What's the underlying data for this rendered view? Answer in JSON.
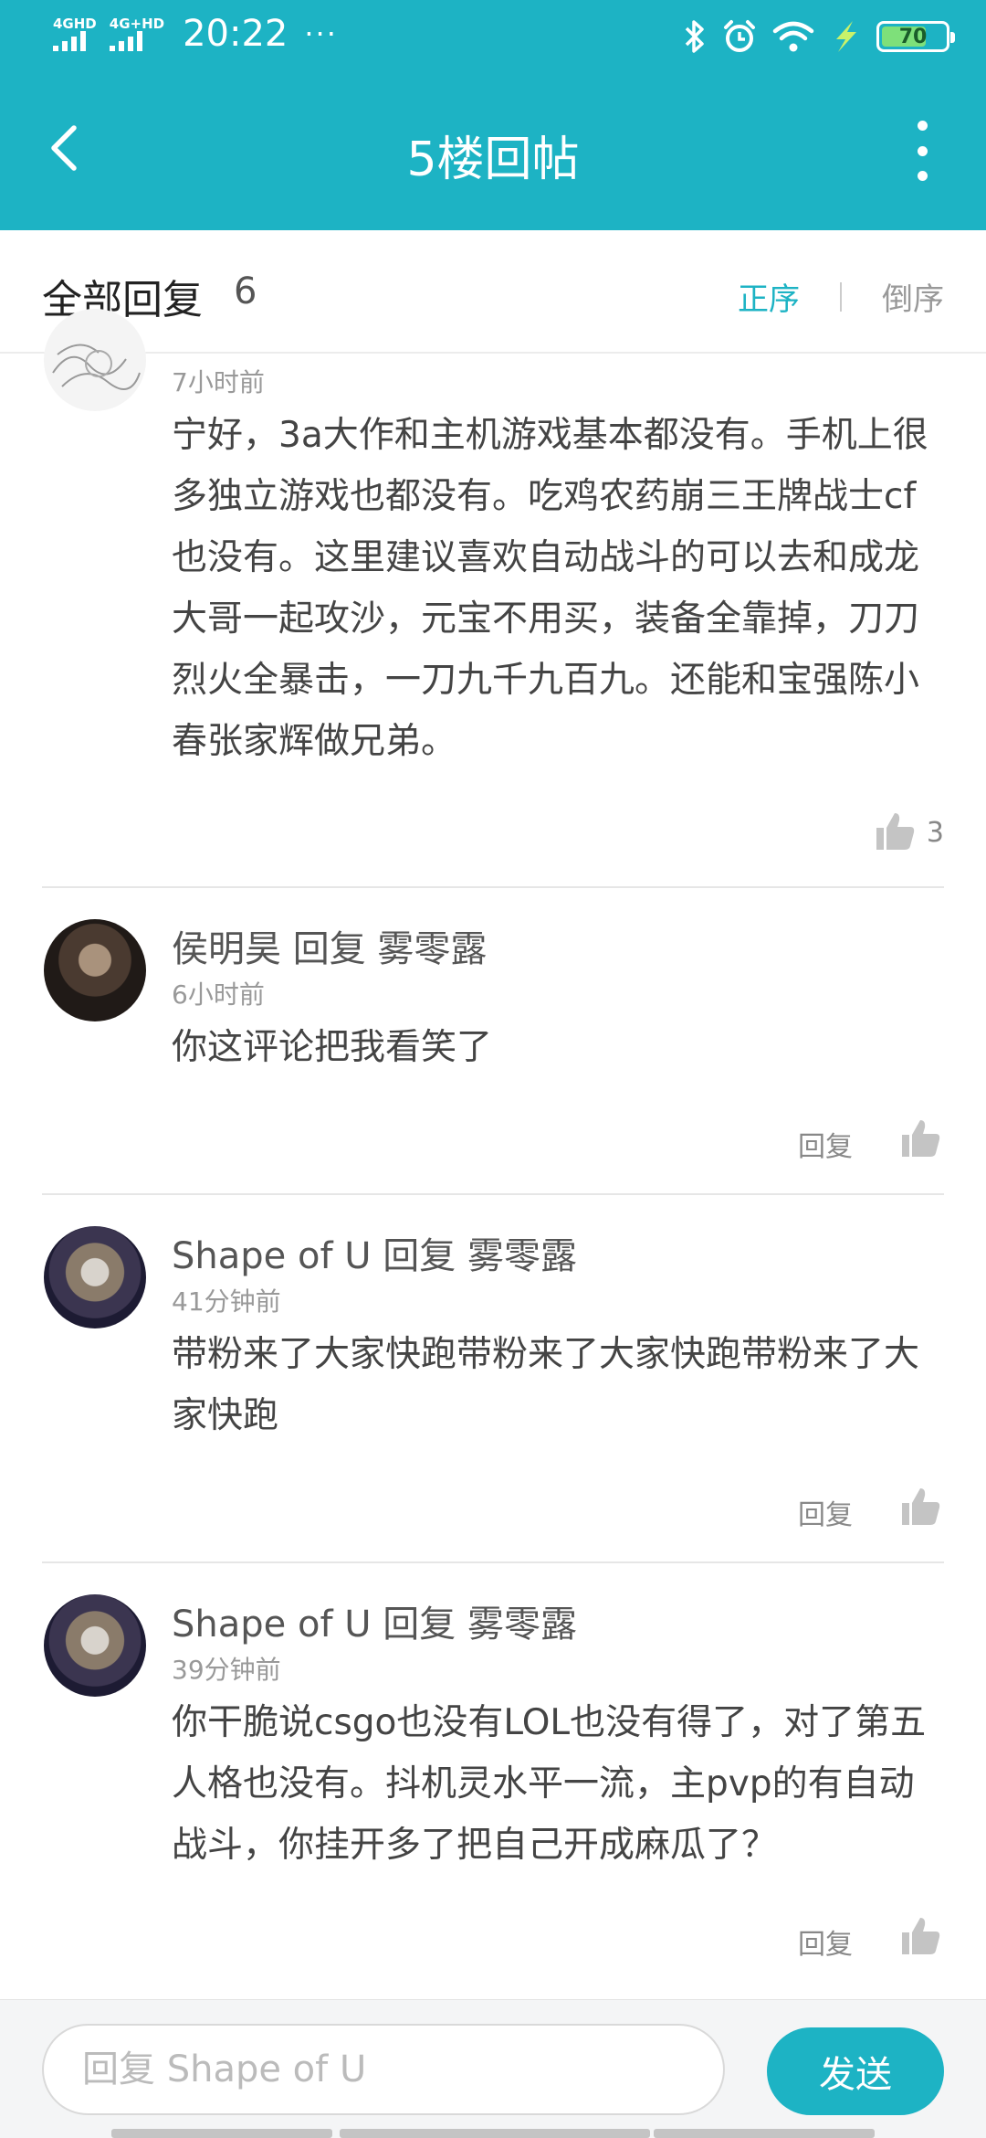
{
  "status_bar": {
    "network_1": "4GHD",
    "network_2": "4G+HD",
    "time": "20:22",
    "dots": "···",
    "battery": "70",
    "battery_fraction": 0.7
  },
  "app_bar": {
    "title": "5楼回帖"
  },
  "subheader": {
    "label": "全部回复",
    "count": "6",
    "sort_asc": "正序",
    "sort_desc": "倒序"
  },
  "comments": [
    {
      "time": "7小时前",
      "text": "宁好，3a大作和主机游戏基本都没有。手机上很多独立游戏也都没有。吃鸡农药崩三王牌战士cf也没有。这里建议喜欢自动战斗的可以去和成龙大哥一起攻沙，元宝不用买，装备全靠掉，刀刀烈火全暴击，一刀九千九百九。还能和宝强陈小春张家辉做兄弟。",
      "likes": "3"
    },
    {
      "name": "侯明昊 回复 雾零露",
      "time": "6小时前",
      "text": "你这评论把我看笑了",
      "reply": "回复"
    },
    {
      "name": "Shape of U 回复 雾零露",
      "time": "41分钟前",
      "text": "带粉来了大家快跑带粉来了大家快跑带粉来了大家快跑",
      "reply": "回复"
    },
    {
      "name": "Shape of U 回复 雾零露",
      "time": "39分钟前",
      "text": "你干脆说csgo也没有LOL也没有得了，对了第五人格也没有。抖机灵水平一流，主pvp的有自动战斗，你挂开多了把自己开成麻瓜了？",
      "reply": "回复"
    }
  ],
  "input_bar": {
    "placeholder": "回复 Shape of U",
    "send_label": "发送"
  },
  "colors": {
    "accent": "#1db3c4",
    "like_icon": "#bfbfbf"
  },
  "icons": [
    "back-arrow-icon",
    "more-vert-icon",
    "thumbs-up-icon",
    "bluetooth-icon",
    "alarm-icon",
    "wifi-icon",
    "charging-icon",
    "battery-icon",
    "signal-icon"
  ]
}
